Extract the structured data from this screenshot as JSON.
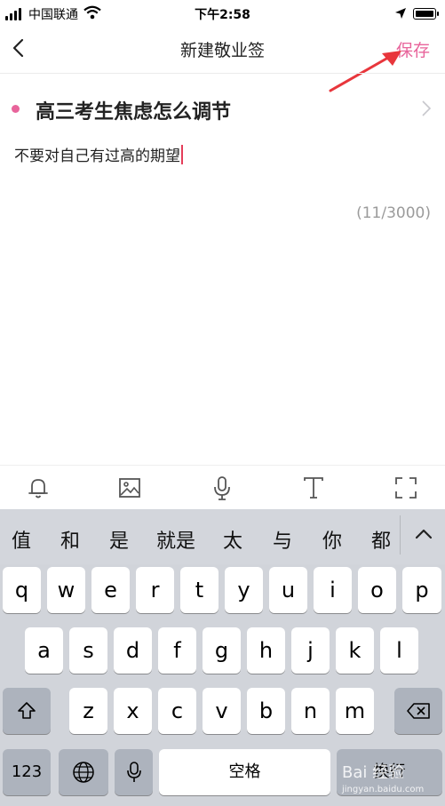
{
  "status_bar": {
    "carrier": "中国联通",
    "time": "下午2:58"
  },
  "nav": {
    "title": "新建敬业签",
    "save_label": "保存"
  },
  "note": {
    "title": "高三考生焦虑怎么调节",
    "body": "不要对自己有过高的期望",
    "counter": "(11/3000)"
  },
  "toolbar": {
    "tools": [
      "bell-icon",
      "image-icon",
      "microphone-icon",
      "text-format-icon",
      "fullscreen-icon"
    ]
  },
  "keyboard": {
    "candidates": [
      "值",
      "和",
      "是",
      "就是",
      "太",
      "与",
      "你",
      "都"
    ],
    "row1": [
      "q",
      "w",
      "e",
      "r",
      "t",
      "y",
      "u",
      "i",
      "o",
      "p"
    ],
    "row2": [
      "a",
      "s",
      "d",
      "f",
      "g",
      "h",
      "j",
      "k",
      "l"
    ],
    "row3": [
      "z",
      "x",
      "c",
      "v",
      "b",
      "n",
      "m"
    ],
    "numbers_label": "123",
    "space_label": "空格",
    "return_label": "换行"
  },
  "watermark": {
    "brand": "Bai 经验",
    "url": "jingyan.baidu.com"
  },
  "colors": {
    "accent": "#e8649b",
    "caret": "#e53e5a",
    "keyboard_bg": "#d1d4da"
  }
}
